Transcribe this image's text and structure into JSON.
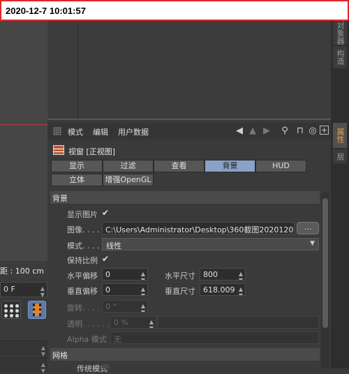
{
  "timestamp": "2020-12-7  10:01:57",
  "viewport": {
    "grid_distance": "距 : 100 cm",
    "frame": "0 F"
  },
  "right_tabs": [
    "对象器",
    "构造",
    "属性",
    "层"
  ],
  "menubar": {
    "items": [
      "模式",
      "编辑",
      "用户数据"
    ]
  },
  "panel_title": "视窗 [正视图]",
  "tabs_row1": [
    "显示",
    "过滤",
    "查看",
    "背景",
    "HUD"
  ],
  "tabs_row2": [
    "立体",
    "增强OpenGL"
  ],
  "active_tab": "背景",
  "section_background": "背景",
  "section_grid": "网格",
  "fields": {
    "show_image_label": "显示图片",
    "show_image_checked": "✔",
    "image_label": "图像. . . .",
    "image_value": "C:\\Users\\Administrator\\Desktop\\360截图2020120",
    "browse_label": "...",
    "mode_label": "模式. . . . .",
    "mode_value": "线性",
    "keep_ratio_label": "保持比例",
    "keep_ratio_checked": "✔",
    "h_offset_label": "水平偏移",
    "h_offset_value": "0",
    "h_size_label": "水平尺寸",
    "h_size_value": "800",
    "v_offset_label": "垂直偏移",
    "v_offset_value": "0",
    "v_size_label": "垂直尺寸",
    "v_size_value": "618.009",
    "rotate_label": "旋转. . . . .",
    "rotate_value": "0 °",
    "transparency_label": "透明. . . . . .",
    "transparency_value": "0 %",
    "alpha_label": "Alpha 模式",
    "alpha_value": "无",
    "grid_partial_label": "传统模式"
  },
  "colors": {
    "accent_tab": "#8aa2c8",
    "timestamp_border": "#e0262a",
    "active_side_tab": "#e8a64a"
  }
}
